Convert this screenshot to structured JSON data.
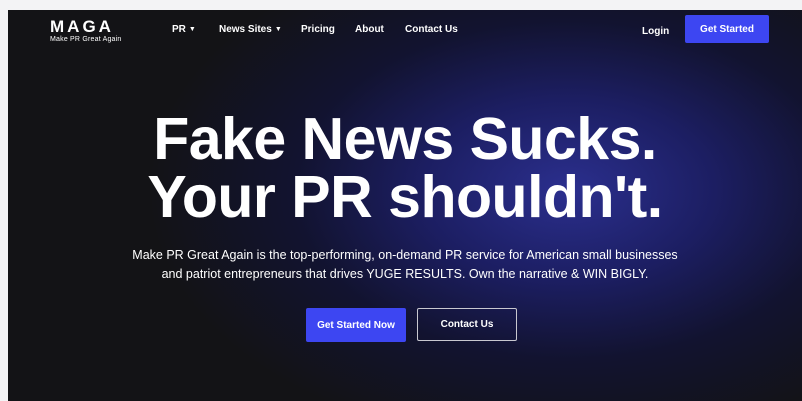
{
  "logo": {
    "word": "MAGA",
    "tagline": "Make PR Great Again"
  },
  "nav": {
    "items": [
      {
        "label": "PR",
        "dropdown": true
      },
      {
        "label": "News Sites",
        "dropdown": true
      },
      {
        "label": "Pricing",
        "dropdown": false
      },
      {
        "label": "About",
        "dropdown": false
      },
      {
        "label": "Contact Us",
        "dropdown": false
      }
    ],
    "login_label": "Login",
    "cta_label": "Get Started"
  },
  "hero": {
    "headline_line1": "Fake News Sucks.",
    "headline_line2": "Your PR shouldn't.",
    "sub_line1": "Make PR Great Again is the top-performing, on-demand PR service for American small businesses",
    "sub_line2": "and patriot entrepreneurs that drives YUGE RESULTS. Own the narrative & WIN BIGLY.",
    "primary_label": "Get Started Now",
    "secondary_label": "Contact Us"
  },
  "icons": {
    "dropdown": "chevron-down-icon"
  },
  "colors": {
    "accent": "#3d46f2",
    "background": "#131316",
    "glow": "#2b2f8e"
  }
}
